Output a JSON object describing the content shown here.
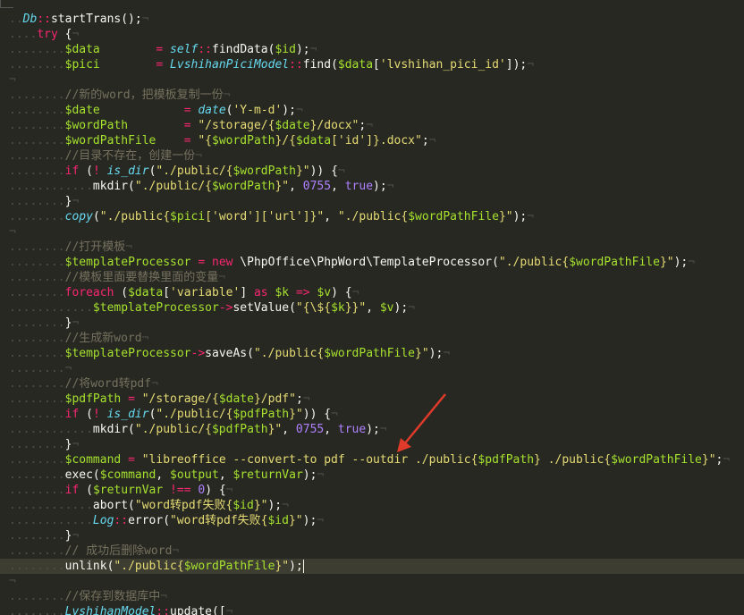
{
  "editor": {
    "accent_arrow_color": "#e03b2a",
    "lines": [
      [
        [
          "dots",
          ".."
        ],
        [
          "cls",
          "Db"
        ],
        [
          "op",
          "::"
        ],
        [
          "f",
          "startTrans();"
        ],
        [
          "ws",
          "¬"
        ]
      ],
      [
        [
          "dots",
          "...."
        ],
        [
          "k",
          "try"
        ],
        [
          "f",
          " {"
        ],
        [
          "ws",
          "¬"
        ]
      ],
      [
        [
          "dots",
          "........"
        ],
        [
          "v",
          "$data"
        ],
        [
          "f",
          "        "
        ],
        [
          "op",
          "="
        ],
        [
          "f",
          " "
        ],
        [
          "cls",
          "self"
        ],
        [
          "op",
          "::"
        ],
        [
          "f",
          "findData("
        ],
        [
          "v",
          "$id"
        ],
        [
          "f",
          ");"
        ],
        [
          "ws",
          "¬"
        ]
      ],
      [
        [
          "dots",
          "........"
        ],
        [
          "v",
          "$pici"
        ],
        [
          "f",
          "        "
        ],
        [
          "op",
          "="
        ],
        [
          "f",
          " "
        ],
        [
          "cls",
          "LvshihanPiciModel"
        ],
        [
          "op",
          "::"
        ],
        [
          "f",
          "find("
        ],
        [
          "v",
          "$data"
        ],
        [
          "f",
          "["
        ],
        [
          "s",
          "'lvshihan_pici_id'"
        ],
        [
          "f",
          "]);"
        ],
        [
          "ws",
          "¬"
        ]
      ],
      [
        [
          "ws",
          "¬"
        ]
      ],
      [
        [
          "dots",
          "........"
        ],
        [
          "c",
          "//新的word，把模板复制一份"
        ],
        [
          "ws",
          "¬"
        ]
      ],
      [
        [
          "dots",
          "........"
        ],
        [
          "v",
          "$date"
        ],
        [
          "f",
          "            "
        ],
        [
          "op",
          "="
        ],
        [
          "f",
          " "
        ],
        [
          "cls",
          "date"
        ],
        [
          "f",
          "("
        ],
        [
          "s",
          "'Y-m-d'"
        ],
        [
          "f",
          ");"
        ],
        [
          "ws",
          "¬"
        ]
      ],
      [
        [
          "dots",
          "........"
        ],
        [
          "v",
          "$wordPath"
        ],
        [
          "f",
          "        "
        ],
        [
          "op",
          "="
        ],
        [
          "f",
          " "
        ],
        [
          "s",
          "\"/storage/{"
        ],
        [
          "v",
          "$date"
        ],
        [
          "s",
          "}/docx\""
        ],
        [
          "f",
          ";"
        ],
        [
          "ws",
          "¬"
        ]
      ],
      [
        [
          "dots",
          "........"
        ],
        [
          "v",
          "$wordPathFile"
        ],
        [
          "f",
          "    "
        ],
        [
          "op",
          "="
        ],
        [
          "f",
          " "
        ],
        [
          "s",
          "\"{"
        ],
        [
          "v",
          "$wordPath"
        ],
        [
          "s",
          "}/{"
        ],
        [
          "v",
          "$data"
        ],
        [
          "s",
          "['id']}.docx\""
        ],
        [
          "f",
          ";"
        ],
        [
          "ws",
          "¬"
        ]
      ],
      [
        [
          "dots",
          "........"
        ],
        [
          "c",
          "//目录不存在，创建一份"
        ],
        [
          "ws",
          "¬"
        ]
      ],
      [
        [
          "dots",
          "........"
        ],
        [
          "k",
          "if"
        ],
        [
          "f",
          " ("
        ],
        [
          "op",
          "!"
        ],
        [
          "f",
          " "
        ],
        [
          "cls",
          "is_dir"
        ],
        [
          "f",
          "("
        ],
        [
          "s",
          "\"./public/{"
        ],
        [
          "v",
          "$wordPath"
        ],
        [
          "s",
          "}\""
        ],
        [
          "f",
          "))"
        ],
        [
          "f",
          " {"
        ],
        [
          "ws",
          "¬"
        ]
      ],
      [
        [
          "dots",
          "............"
        ],
        [
          "f",
          "mkdir("
        ],
        [
          "s",
          "\"./public/{"
        ],
        [
          "v",
          "$wordPath"
        ],
        [
          "s",
          "}\""
        ],
        [
          "f",
          ", "
        ],
        [
          "n",
          "0755"
        ],
        [
          "f",
          ", "
        ],
        [
          "n",
          "true"
        ],
        [
          "f",
          ");"
        ],
        [
          "ws",
          "¬"
        ]
      ],
      [
        [
          "dots",
          "........"
        ],
        [
          "f",
          "}"
        ],
        [
          "ws",
          "¬"
        ]
      ],
      [
        [
          "dots",
          "........"
        ],
        [
          "cls",
          "copy"
        ],
        [
          "f",
          "("
        ],
        [
          "s",
          "\"./public{"
        ],
        [
          "v",
          "$pici"
        ],
        [
          "s",
          "['word']['url']}\""
        ],
        [
          "f",
          ", "
        ],
        [
          "s",
          "\"./public{"
        ],
        [
          "v",
          "$wordPathFile"
        ],
        [
          "s",
          "}\""
        ],
        [
          "f",
          ");"
        ],
        [
          "ws",
          "¬"
        ]
      ],
      [
        [
          "ws",
          "¬"
        ]
      ],
      [
        [
          "dots",
          "........"
        ],
        [
          "c",
          "//打开模板"
        ],
        [
          "ws",
          "¬"
        ]
      ],
      [
        [
          "dots",
          "........"
        ],
        [
          "v",
          "$templateProcessor"
        ],
        [
          "f",
          " "
        ],
        [
          "op",
          "="
        ],
        [
          "f",
          " "
        ],
        [
          "k",
          "new"
        ],
        [
          "f",
          " \\PhpOffice\\PhpWord\\TemplateProcessor("
        ],
        [
          "s",
          "\"./public{"
        ],
        [
          "v",
          "$wordPathFile"
        ],
        [
          "s",
          "}\""
        ],
        [
          "f",
          ");"
        ],
        [
          "ws",
          "¬"
        ]
      ],
      [
        [
          "dots",
          "........"
        ],
        [
          "c",
          "//模板里面要替换里面的变量"
        ],
        [
          "ws",
          "¬"
        ]
      ],
      [
        [
          "dots",
          "........"
        ],
        [
          "k",
          "foreach"
        ],
        [
          "f",
          " ("
        ],
        [
          "v",
          "$data"
        ],
        [
          "f",
          "["
        ],
        [
          "s",
          "'variable'"
        ],
        [
          "f",
          "] "
        ],
        [
          "k",
          "as"
        ],
        [
          "f",
          " "
        ],
        [
          "v",
          "$k"
        ],
        [
          "f",
          " "
        ],
        [
          "op",
          "=>"
        ],
        [
          "f",
          " "
        ],
        [
          "v",
          "$v"
        ],
        [
          "f",
          ") {"
        ],
        [
          "ws",
          "¬"
        ]
      ],
      [
        [
          "dots",
          "............"
        ],
        [
          "v",
          "$templateProcessor"
        ],
        [
          "op",
          "->"
        ],
        [
          "f",
          "setValue("
        ],
        [
          "s",
          "\"{\\${"
        ],
        [
          "v",
          "$k"
        ],
        [
          "s",
          "}}\""
        ],
        [
          "f",
          ", "
        ],
        [
          "v",
          "$v"
        ],
        [
          "f",
          ");"
        ],
        [
          "ws",
          "¬"
        ]
      ],
      [
        [
          "dots",
          "........"
        ],
        [
          "f",
          "}"
        ],
        [
          "ws",
          "¬"
        ]
      ],
      [
        [
          "dots",
          "........"
        ],
        [
          "c",
          "//生成新word"
        ],
        [
          "ws",
          "¬"
        ]
      ],
      [
        [
          "dots",
          "........"
        ],
        [
          "v",
          "$templateProcessor"
        ],
        [
          "op",
          "->"
        ],
        [
          "f",
          "saveAs("
        ],
        [
          "s",
          "\"./public{"
        ],
        [
          "v",
          "$wordPathFile"
        ],
        [
          "s",
          "}\""
        ],
        [
          "f",
          ");"
        ],
        [
          "ws",
          "¬"
        ]
      ],
      [
        [
          "dots",
          "........"
        ],
        [
          "ws",
          "¬"
        ]
      ],
      [
        [
          "dots",
          "........"
        ],
        [
          "c",
          "//将word转pdf"
        ],
        [
          "ws",
          "¬"
        ]
      ],
      [
        [
          "dots",
          "........"
        ],
        [
          "v",
          "$pdfPath"
        ],
        [
          "f",
          " "
        ],
        [
          "op",
          "="
        ],
        [
          "f",
          " "
        ],
        [
          "s",
          "\"/storage/{"
        ],
        [
          "v",
          "$date"
        ],
        [
          "s",
          "}/pdf\""
        ],
        [
          "f",
          ";"
        ],
        [
          "ws",
          "¬"
        ]
      ],
      [
        [
          "dots",
          "........"
        ],
        [
          "k",
          "if"
        ],
        [
          "f",
          " ("
        ],
        [
          "op",
          "!"
        ],
        [
          "f",
          " "
        ],
        [
          "cls",
          "is_dir"
        ],
        [
          "f",
          "("
        ],
        [
          "s",
          "\"./public/{"
        ],
        [
          "v",
          "$pdfPath"
        ],
        [
          "s",
          "}\""
        ],
        [
          "f",
          "))"
        ],
        [
          "f",
          " {"
        ],
        [
          "ws",
          "¬"
        ]
      ],
      [
        [
          "dots",
          "............"
        ],
        [
          "f",
          "mkdir("
        ],
        [
          "s",
          "\"./public/{"
        ],
        [
          "v",
          "$pdfPath"
        ],
        [
          "s",
          "}\""
        ],
        [
          "f",
          ", "
        ],
        [
          "n",
          "0755"
        ],
        [
          "f",
          ", "
        ],
        [
          "n",
          "true"
        ],
        [
          "f",
          ");"
        ],
        [
          "ws",
          "¬"
        ]
      ],
      [
        [
          "dots",
          "........"
        ],
        [
          "f",
          "}"
        ],
        [
          "ws",
          "¬"
        ]
      ],
      [
        [
          "dots",
          "........"
        ],
        [
          "v",
          "$command"
        ],
        [
          "f",
          " "
        ],
        [
          "op",
          "="
        ],
        [
          "f",
          " "
        ],
        [
          "s",
          "\"libreoffice --convert-to pdf --outdir ./public{"
        ],
        [
          "v",
          "$pdfPath"
        ],
        [
          "s",
          "} ./public{"
        ],
        [
          "v",
          "$wordPathFile"
        ],
        [
          "s",
          "}\""
        ],
        [
          "f",
          ";"
        ],
        [
          "ws",
          "¬"
        ]
      ],
      [
        [
          "dots",
          "........"
        ],
        [
          "f",
          "exec("
        ],
        [
          "v",
          "$command"
        ],
        [
          "f",
          ", "
        ],
        [
          "v",
          "$output"
        ],
        [
          "f",
          ", "
        ],
        [
          "v",
          "$returnVar"
        ],
        [
          "f",
          ");"
        ],
        [
          "ws",
          "¬"
        ]
      ],
      [
        [
          "dots",
          "........"
        ],
        [
          "k",
          "if"
        ],
        [
          "f",
          " ("
        ],
        [
          "v",
          "$returnVar"
        ],
        [
          "f",
          " "
        ],
        [
          "op",
          "!=="
        ],
        [
          "f",
          " "
        ],
        [
          "n",
          "0"
        ],
        [
          "f",
          ") {"
        ],
        [
          "ws",
          "¬"
        ]
      ],
      [
        [
          "dots",
          "............"
        ],
        [
          "f",
          "abort("
        ],
        [
          "s",
          "\"word转pdf失败{"
        ],
        [
          "v",
          "$id"
        ],
        [
          "s",
          "}\""
        ],
        [
          "f",
          ");"
        ],
        [
          "ws",
          "¬"
        ]
      ],
      [
        [
          "dots",
          "............"
        ],
        [
          "cls",
          "Log"
        ],
        [
          "op",
          "::"
        ],
        [
          "f",
          "error("
        ],
        [
          "s",
          "\"word转pdf失败{"
        ],
        [
          "v",
          "$id"
        ],
        [
          "s",
          "}\""
        ],
        [
          "f",
          ");"
        ],
        [
          "ws",
          "¬"
        ]
      ],
      [
        [
          "dots",
          "........"
        ],
        [
          "f",
          "}"
        ],
        [
          "ws",
          "¬"
        ]
      ],
      [
        [
          "dots",
          "........"
        ],
        [
          "c",
          "// 成功后删除word"
        ],
        [
          "ws",
          "¬"
        ]
      ],
      [
        [
          "dots",
          "........"
        ],
        [
          "f",
          "unlink("
        ],
        [
          "s",
          "\"./public{"
        ],
        [
          "v",
          "$wordPathFile"
        ],
        [
          "s",
          "}\""
        ],
        [
          "f",
          ");"
        ]
      ],
      [
        [
          "ws",
          "¬"
        ]
      ],
      [
        [
          "dots",
          "........"
        ],
        [
          "c",
          "//保存到数据库中"
        ],
        [
          "ws",
          "¬"
        ]
      ],
      [
        [
          "dots",
          "........"
        ],
        [
          "cls",
          "LvshihanModel"
        ],
        [
          "op",
          "::"
        ],
        [
          "f",
          "update(["
        ],
        [
          "ws",
          "¬"
        ]
      ]
    ]
  }
}
